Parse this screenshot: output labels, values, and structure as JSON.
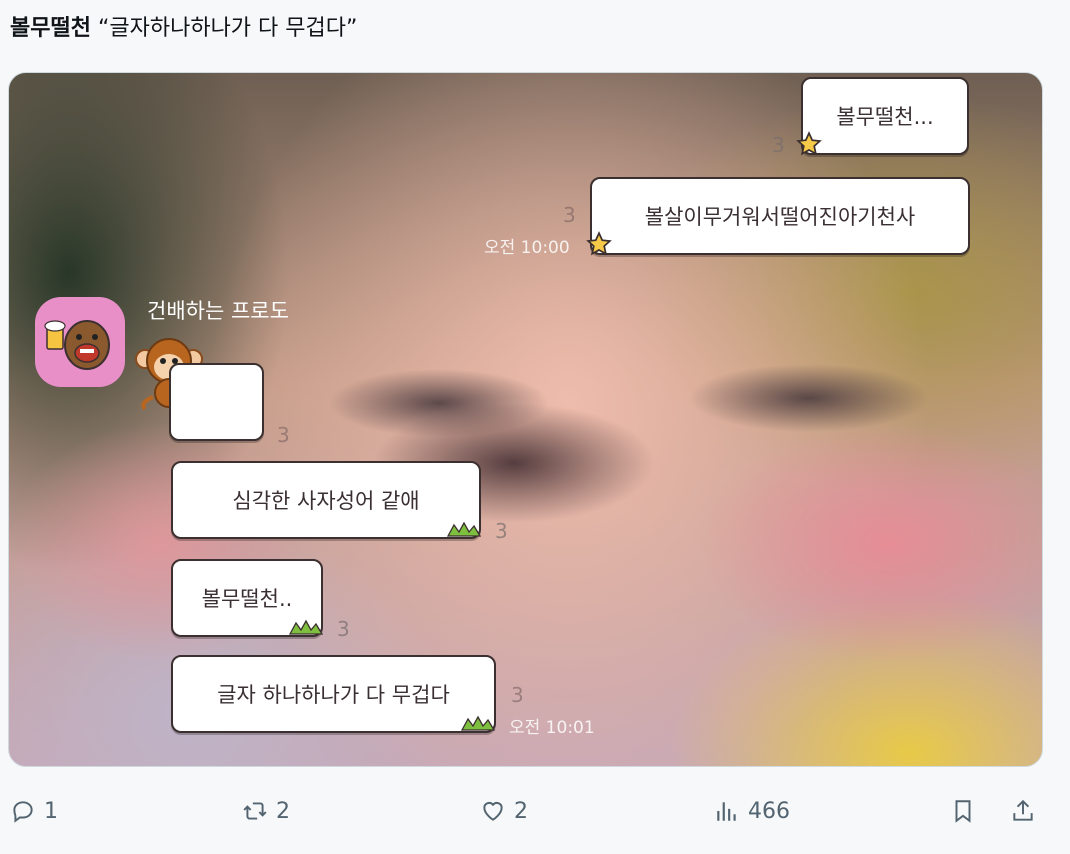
{
  "post": {
    "author": "볼무떨천",
    "quote": "“글자하나하나가 다 무겁다”"
  },
  "chat": {
    "sent": [
      {
        "text": "볼무떨천...",
        "read": "3"
      },
      {
        "text": "볼살이무거워서떨어진아기천사",
        "read": "3",
        "time": "오전 10:00"
      }
    ],
    "sender_name": "건배하는 프로도",
    "received": [
      {
        "text": "",
        "read": "3"
      },
      {
        "text": "심각한 사자성어 같애",
        "read": "3"
      },
      {
        "text": "볼무떨천..",
        "read": "3"
      },
      {
        "text": "글자 하나하나가 다 무겁다",
        "read": "3",
        "time": "오전 10:01"
      }
    ]
  },
  "actions": {
    "replies": "1",
    "reposts": "2",
    "likes": "2",
    "views": "466"
  },
  "icons": [
    "reply-icon",
    "repost-icon",
    "like-icon",
    "views-icon",
    "bookmark-icon",
    "share-icon",
    "star-sticker-icon",
    "grass-sticker-icon"
  ],
  "colors": {
    "bubble_border": "#3b2f2f",
    "action_grey": "#536471",
    "avatar_bg": "#e88fc8"
  }
}
